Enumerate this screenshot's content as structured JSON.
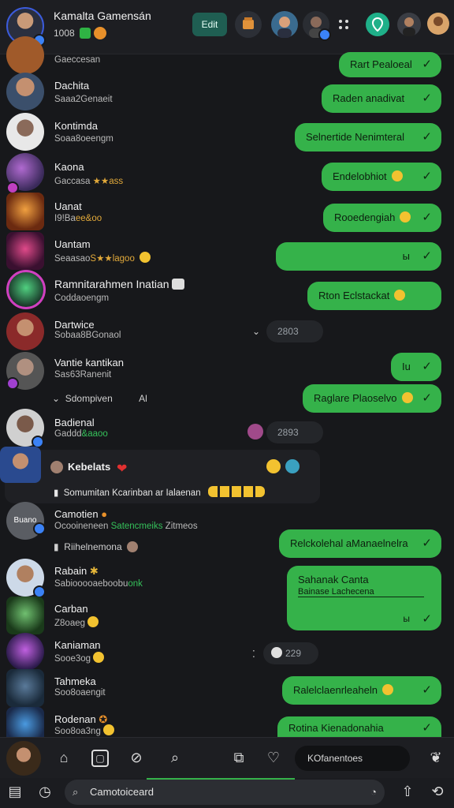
{
  "header": {
    "title": "Kamalta Gamensán",
    "subtitle": "1008",
    "button_label": "Edit"
  },
  "chats": [
    {
      "name": "",
      "sub": "Gaeccesan",
      "avatar": "#a05a2a"
    },
    {
      "name": "Dachita",
      "sub": "Saaa2Genaeit",
      "avatar": "#3b4f6b"
    },
    {
      "name": "Kontimda",
      "sub": "Soaa8oeengm",
      "avatar": "#e8e8e8"
    },
    {
      "name": "Kaona",
      "sub": "Gaccasa",
      "sub_hl": "★★ass",
      "avatar": "#6b3f8f"
    },
    {
      "name": "Uanat",
      "sub": "I9!Ba",
      "sub_hl": "ee&oo",
      "avatar": "#c9622a"
    },
    {
      "name": "Uantam",
      "sub": "Seaasao",
      "sub_hl": "S★★lagoo",
      "avatar": "#8f2a4a"
    },
    {
      "name": "Ramnitarahmen Inatian",
      "sub": "Coddaoengm",
      "avatar": "#2a6b4a"
    },
    {
      "name": "Dartwice",
      "sub": "Sobaa8BGonaol",
      "avatar": "#8b2a2a"
    },
    {
      "name": "Vantie kantikan",
      "sub": "Sas63Ranenit",
      "avatar": "#6b6b6b"
    },
    {
      "name": "Badienal",
      "sub": "Gaddd",
      "sub_gr": "&aaoo",
      "avatar": "#d0d0d0"
    },
    {
      "name": "Kebelats",
      "sub": "Somumitan Kcarinban ar Ialaenan",
      "avatar": "#2a4a8f"
    },
    {
      "name": "Camotien",
      "sub": "Ocooineneen",
      "sub_gr": "Satencmeiks",
      "sub_tail": "Zitmeos",
      "avatar": "#5a5d63",
      "avatar_label": "Buano"
    },
    {
      "name": "Rabain",
      "sub": "Sabiooooaeboobu",
      "sub_gr": "onk",
      "avatar": "#cdd9e8"
    },
    {
      "name": "Carban",
      "sub": "Z8oaeg",
      "avatar": "#2a5a3a"
    },
    {
      "name": "Kaniaman",
      "sub": "Sooe3og",
      "avatar": "#5a2a8f"
    },
    {
      "name": "Tahmeka",
      "sub": "Soo8oaengit",
      "avatar": "#2a3a4a"
    },
    {
      "name": "Rodenan",
      "sub": "Soo8oa3ng",
      "avatar": "#2a5a8f"
    }
  ],
  "bubbles": {
    "b0": "Rart Pealoeal",
    "b1": "Raden anadivat",
    "b2": "Selnertide Nenimteral",
    "b3": "Endelobhiot",
    "b4": "Rooedengiah",
    "b5": "ы",
    "b6": "Rton Eclstackat",
    "b7": "Iu",
    "b8": "Raglare Plaoselvo",
    "b9": "Relckolehal aManaelnelra",
    "b10_line1": "Sahanak Canta",
    "b10_line2": "Bainase Lachecena",
    "b10_tail": "ы",
    "b11": "Ralelclaenrleaheln",
    "b12": "Rotina Kienadonahia"
  },
  "pills": {
    "p0": "2803",
    "p1": "2893",
    "p2": "229"
  },
  "notes": {
    "selection": "Sdompiven",
    "selection_tail": "Al",
    "sub_note": "Riihelnemona"
  },
  "expanded_sub": "Somumitan Kcarinban ar Ialaenan",
  "bottom": {
    "field": "KOfanentoes",
    "search_placeholder": "Camotoiceard"
  },
  "colors": {
    "accent": "#35b24a",
    "background": "#17181b",
    "bar": "#1d1e22"
  }
}
